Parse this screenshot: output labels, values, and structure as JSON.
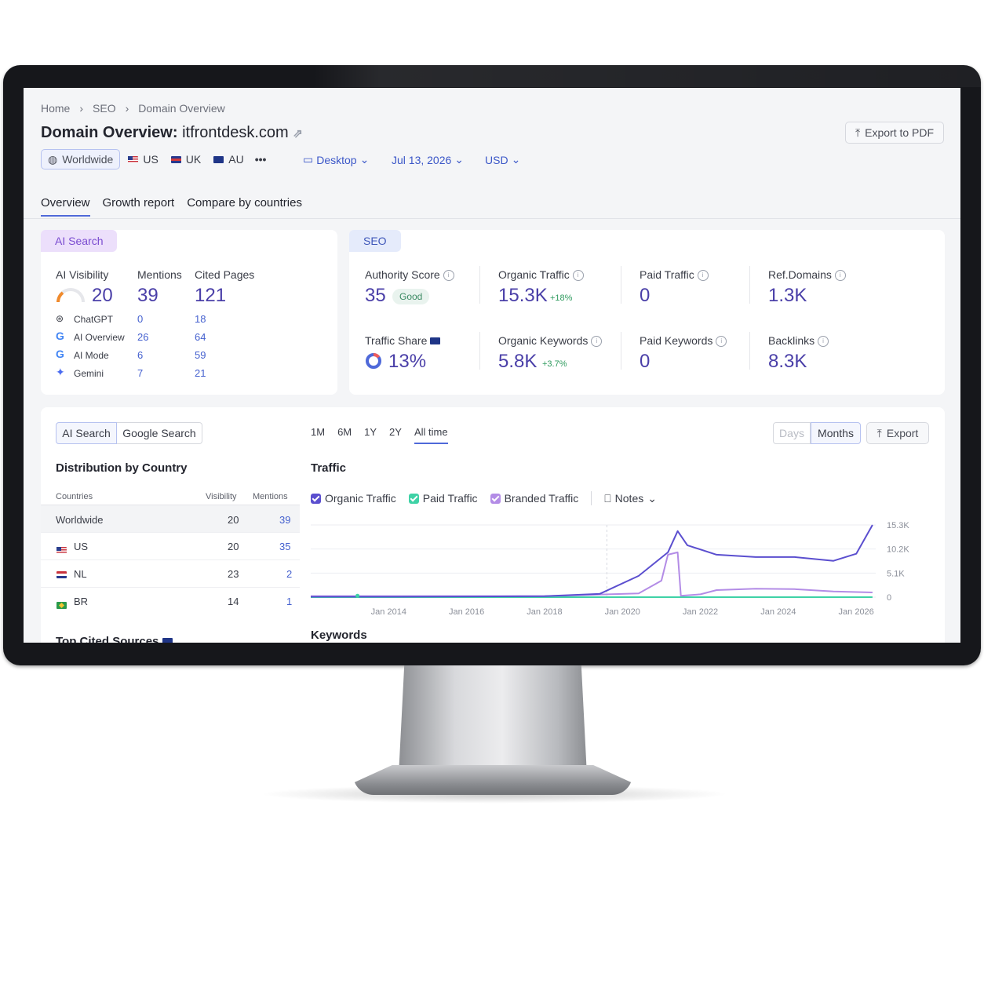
{
  "breadcrumb": [
    "Home",
    "SEO",
    "Domain Overview"
  ],
  "page": {
    "title_prefix": "Domain Overview:",
    "domain": "itfrontdesk.com",
    "export_pdf": "Export to PDF"
  },
  "regions": [
    {
      "label": "Worldwide",
      "selected": true
    },
    {
      "label": "US",
      "flag": "us"
    },
    {
      "label": "UK",
      "flag": "uk"
    },
    {
      "label": "AU",
      "flag": "au"
    }
  ],
  "more_label": "•••",
  "filters": {
    "device": "Desktop",
    "date": "Jul 13, 2026",
    "currency": "USD"
  },
  "tabs": [
    "Overview",
    "Growth report",
    "Compare by countries"
  ],
  "ai_search": {
    "pill": "AI Search",
    "headers": [
      "AI Visibility",
      "Mentions",
      "Cited Pages"
    ],
    "visibility": "20",
    "mentions": "39",
    "cited_pages": "121",
    "rows": [
      {
        "name": "ChatGPT",
        "mentions": "0",
        "cited": "18"
      },
      {
        "name": "AI Overview",
        "mentions": "26",
        "cited": "64"
      },
      {
        "name": "AI Mode",
        "mentions": "6",
        "cited": "59"
      },
      {
        "name": "Gemini",
        "mentions": "7",
        "cited": "21"
      }
    ]
  },
  "seo": {
    "pill": "SEO",
    "authority_label": "Authority Score",
    "authority_value": "35",
    "authority_badge": "Good",
    "organic_traffic_label": "Organic Traffic",
    "organic_traffic_value": "15.3K",
    "organic_traffic_delta": "+18%",
    "paid_traffic_label": "Paid Traffic",
    "paid_traffic_value": "0",
    "ref_domains_label": "Ref.Domains",
    "ref_domains_value": "1.3K",
    "traffic_share_label": "Traffic Share",
    "traffic_share_value": "13%",
    "organic_keywords_label": "Organic Keywords",
    "organic_keywords_value": "5.8K",
    "organic_keywords_delta": "+3.7%",
    "paid_keywords_label": "Paid Keywords",
    "paid_keywords_value": "0",
    "backlinks_label": "Backlinks",
    "backlinks_value": "8.3K"
  },
  "lower": {
    "toggle": [
      "AI Search",
      "Google Search"
    ],
    "distribution_title": "Distribution by Country",
    "table_headers": [
      "Countries",
      "Visibility",
      "Mentions"
    ],
    "rows": [
      {
        "country": "Worldwide",
        "visibility": "20",
        "mentions": "39"
      },
      {
        "country": "US",
        "visibility": "20",
        "mentions": "35",
        "flag": "us"
      },
      {
        "country": "NL",
        "visibility": "23",
        "mentions": "2",
        "flag": "nl"
      },
      {
        "country": "BR",
        "visibility": "14",
        "mentions": "1",
        "flag": "br"
      }
    ],
    "top_cited": "Top Cited Sources",
    "ranges": [
      "1M",
      "6M",
      "1Y",
      "2Y",
      "All time"
    ],
    "granularity": [
      "Days",
      "Months"
    ],
    "export": "Export",
    "traffic_title": "Traffic",
    "legend": [
      "Organic Traffic",
      "Paid Traffic",
      "Branded Traffic"
    ],
    "notes": "Notes",
    "keywords_title": "Keywords"
  },
  "colors": {
    "organic": "#5b4fcf",
    "paid": "#3fd2a6",
    "branded": "#b38ce6",
    "accent": "#4f69d9",
    "value": "#4a3fa8"
  },
  "chart_data": {
    "type": "line",
    "x_ticks": [
      "Jan 2014",
      "Jan 2016",
      "Jan 2018",
      "Jan 2020",
      "Jan 2022",
      "Jan 2024",
      "Jan 2026"
    ],
    "y_ticks": [
      "15.3K",
      "10.2K",
      "5.1K",
      "0"
    ],
    "ylim": [
      0,
      15300
    ],
    "series": [
      {
        "name": "Organic Traffic",
        "x": [
          "2012-01",
          "2014-01",
          "2016-01",
          "2018-01",
          "2019-06",
          "2020-06",
          "2021-03",
          "2021-06",
          "2021-09",
          "2022-06",
          "2023-06",
          "2024-06",
          "2025-06",
          "2026-01",
          "2026-06"
        ],
        "values": [
          100,
          100,
          150,
          200,
          700,
          4500,
          9500,
          14000,
          11000,
          9000,
          8500,
          8500,
          7700,
          9200,
          15300
        ]
      },
      {
        "name": "Paid Traffic",
        "x": [
          "2012-01",
          "2026-06"
        ],
        "values": [
          0,
          0
        ]
      },
      {
        "name": "Branded Traffic",
        "x": [
          "2012-01",
          "2018-01",
          "2020-06",
          "2021-01",
          "2021-03",
          "2021-06",
          "2021-07",
          "2022-01",
          "2022-06",
          "2023-06",
          "2024-06",
          "2025-06",
          "2026-06"
        ],
        "values": [
          200,
          200,
          800,
          3500,
          9000,
          9500,
          300,
          600,
          1500,
          1800,
          1700,
          1200,
          1000
        ]
      }
    ],
    "legend": "top-left",
    "grid": true
  }
}
